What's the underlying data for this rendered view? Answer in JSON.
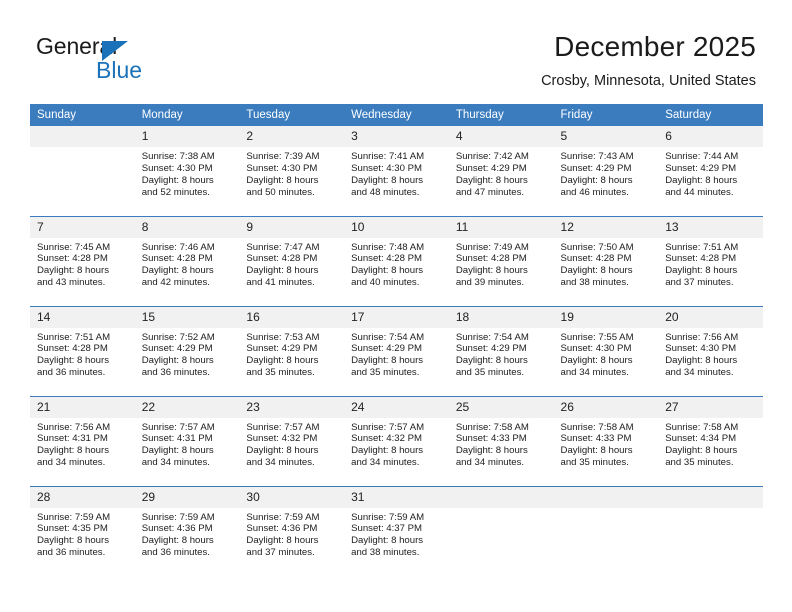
{
  "brand": {
    "name_top": "General",
    "name_bottom": "Blue",
    "logo_icon": "triangle-logo-icon",
    "accent_color": "#1b72b8"
  },
  "header": {
    "title": "December 2025",
    "subtitle": "Crosby, Minnesota, United States"
  },
  "calendar": {
    "header_color": "#3a7cbe",
    "weekday_headers": [
      "Sunday",
      "Monday",
      "Tuesday",
      "Wednesday",
      "Thursday",
      "Friday",
      "Saturday"
    ],
    "weeks": [
      [
        {
          "day": ""
        },
        {
          "day": "1",
          "sunrise": "Sunrise: 7:38 AM",
          "sunset": "Sunset: 4:30 PM",
          "daylight_1": "Daylight: 8 hours",
          "daylight_2": "and 52 minutes."
        },
        {
          "day": "2",
          "sunrise": "Sunrise: 7:39 AM",
          "sunset": "Sunset: 4:30 PM",
          "daylight_1": "Daylight: 8 hours",
          "daylight_2": "and 50 minutes."
        },
        {
          "day": "3",
          "sunrise": "Sunrise: 7:41 AM",
          "sunset": "Sunset: 4:30 PM",
          "daylight_1": "Daylight: 8 hours",
          "daylight_2": "and 48 minutes."
        },
        {
          "day": "4",
          "sunrise": "Sunrise: 7:42 AM",
          "sunset": "Sunset: 4:29 PM",
          "daylight_1": "Daylight: 8 hours",
          "daylight_2": "and 47 minutes."
        },
        {
          "day": "5",
          "sunrise": "Sunrise: 7:43 AM",
          "sunset": "Sunset: 4:29 PM",
          "daylight_1": "Daylight: 8 hours",
          "daylight_2": "and 46 minutes."
        },
        {
          "day": "6",
          "sunrise": "Sunrise: 7:44 AM",
          "sunset": "Sunset: 4:29 PM",
          "daylight_1": "Daylight: 8 hours",
          "daylight_2": "and 44 minutes."
        }
      ],
      [
        {
          "day": "7",
          "sunrise": "Sunrise: 7:45 AM",
          "sunset": "Sunset: 4:28 PM",
          "daylight_1": "Daylight: 8 hours",
          "daylight_2": "and 43 minutes."
        },
        {
          "day": "8",
          "sunrise": "Sunrise: 7:46 AM",
          "sunset": "Sunset: 4:28 PM",
          "daylight_1": "Daylight: 8 hours",
          "daylight_2": "and 42 minutes."
        },
        {
          "day": "9",
          "sunrise": "Sunrise: 7:47 AM",
          "sunset": "Sunset: 4:28 PM",
          "daylight_1": "Daylight: 8 hours",
          "daylight_2": "and 41 minutes."
        },
        {
          "day": "10",
          "sunrise": "Sunrise: 7:48 AM",
          "sunset": "Sunset: 4:28 PM",
          "daylight_1": "Daylight: 8 hours",
          "daylight_2": "and 40 minutes."
        },
        {
          "day": "11",
          "sunrise": "Sunrise: 7:49 AM",
          "sunset": "Sunset: 4:28 PM",
          "daylight_1": "Daylight: 8 hours",
          "daylight_2": "and 39 minutes."
        },
        {
          "day": "12",
          "sunrise": "Sunrise: 7:50 AM",
          "sunset": "Sunset: 4:28 PM",
          "daylight_1": "Daylight: 8 hours",
          "daylight_2": "and 38 minutes."
        },
        {
          "day": "13",
          "sunrise": "Sunrise: 7:51 AM",
          "sunset": "Sunset: 4:28 PM",
          "daylight_1": "Daylight: 8 hours",
          "daylight_2": "and 37 minutes."
        }
      ],
      [
        {
          "day": "14",
          "sunrise": "Sunrise: 7:51 AM",
          "sunset": "Sunset: 4:28 PM",
          "daylight_1": "Daylight: 8 hours",
          "daylight_2": "and 36 minutes."
        },
        {
          "day": "15",
          "sunrise": "Sunrise: 7:52 AM",
          "sunset": "Sunset: 4:29 PM",
          "daylight_1": "Daylight: 8 hours",
          "daylight_2": "and 36 minutes."
        },
        {
          "day": "16",
          "sunrise": "Sunrise: 7:53 AM",
          "sunset": "Sunset: 4:29 PM",
          "daylight_1": "Daylight: 8 hours",
          "daylight_2": "and 35 minutes."
        },
        {
          "day": "17",
          "sunrise": "Sunrise: 7:54 AM",
          "sunset": "Sunset: 4:29 PM",
          "daylight_1": "Daylight: 8 hours",
          "daylight_2": "and 35 minutes."
        },
        {
          "day": "18",
          "sunrise": "Sunrise: 7:54 AM",
          "sunset": "Sunset: 4:29 PM",
          "daylight_1": "Daylight: 8 hours",
          "daylight_2": "and 35 minutes."
        },
        {
          "day": "19",
          "sunrise": "Sunrise: 7:55 AM",
          "sunset": "Sunset: 4:30 PM",
          "daylight_1": "Daylight: 8 hours",
          "daylight_2": "and 34 minutes."
        },
        {
          "day": "20",
          "sunrise": "Sunrise: 7:56 AM",
          "sunset": "Sunset: 4:30 PM",
          "daylight_1": "Daylight: 8 hours",
          "daylight_2": "and 34 minutes."
        }
      ],
      [
        {
          "day": "21",
          "sunrise": "Sunrise: 7:56 AM",
          "sunset": "Sunset: 4:31 PM",
          "daylight_1": "Daylight: 8 hours",
          "daylight_2": "and 34 minutes."
        },
        {
          "day": "22",
          "sunrise": "Sunrise: 7:57 AM",
          "sunset": "Sunset: 4:31 PM",
          "daylight_1": "Daylight: 8 hours",
          "daylight_2": "and 34 minutes."
        },
        {
          "day": "23",
          "sunrise": "Sunrise: 7:57 AM",
          "sunset": "Sunset: 4:32 PM",
          "daylight_1": "Daylight: 8 hours",
          "daylight_2": "and 34 minutes."
        },
        {
          "day": "24",
          "sunrise": "Sunrise: 7:57 AM",
          "sunset": "Sunset: 4:32 PM",
          "daylight_1": "Daylight: 8 hours",
          "daylight_2": "and 34 minutes."
        },
        {
          "day": "25",
          "sunrise": "Sunrise: 7:58 AM",
          "sunset": "Sunset: 4:33 PM",
          "daylight_1": "Daylight: 8 hours",
          "daylight_2": "and 34 minutes."
        },
        {
          "day": "26",
          "sunrise": "Sunrise: 7:58 AM",
          "sunset": "Sunset: 4:33 PM",
          "daylight_1": "Daylight: 8 hours",
          "daylight_2": "and 35 minutes."
        },
        {
          "day": "27",
          "sunrise": "Sunrise: 7:58 AM",
          "sunset": "Sunset: 4:34 PM",
          "daylight_1": "Daylight: 8 hours",
          "daylight_2": "and 35 minutes."
        }
      ],
      [
        {
          "day": "28",
          "sunrise": "Sunrise: 7:59 AM",
          "sunset": "Sunset: 4:35 PM",
          "daylight_1": "Daylight: 8 hours",
          "daylight_2": "and 36 minutes."
        },
        {
          "day": "29",
          "sunrise": "Sunrise: 7:59 AM",
          "sunset": "Sunset: 4:36 PM",
          "daylight_1": "Daylight: 8 hours",
          "daylight_2": "and 36 minutes."
        },
        {
          "day": "30",
          "sunrise": "Sunrise: 7:59 AM",
          "sunset": "Sunset: 4:36 PM",
          "daylight_1": "Daylight: 8 hours",
          "daylight_2": "and 37 minutes."
        },
        {
          "day": "31",
          "sunrise": "Sunrise: 7:59 AM",
          "sunset": "Sunset: 4:37 PM",
          "daylight_1": "Daylight: 8 hours",
          "daylight_2": "and 38 minutes."
        },
        {
          "day": ""
        },
        {
          "day": ""
        },
        {
          "day": ""
        }
      ]
    ]
  }
}
